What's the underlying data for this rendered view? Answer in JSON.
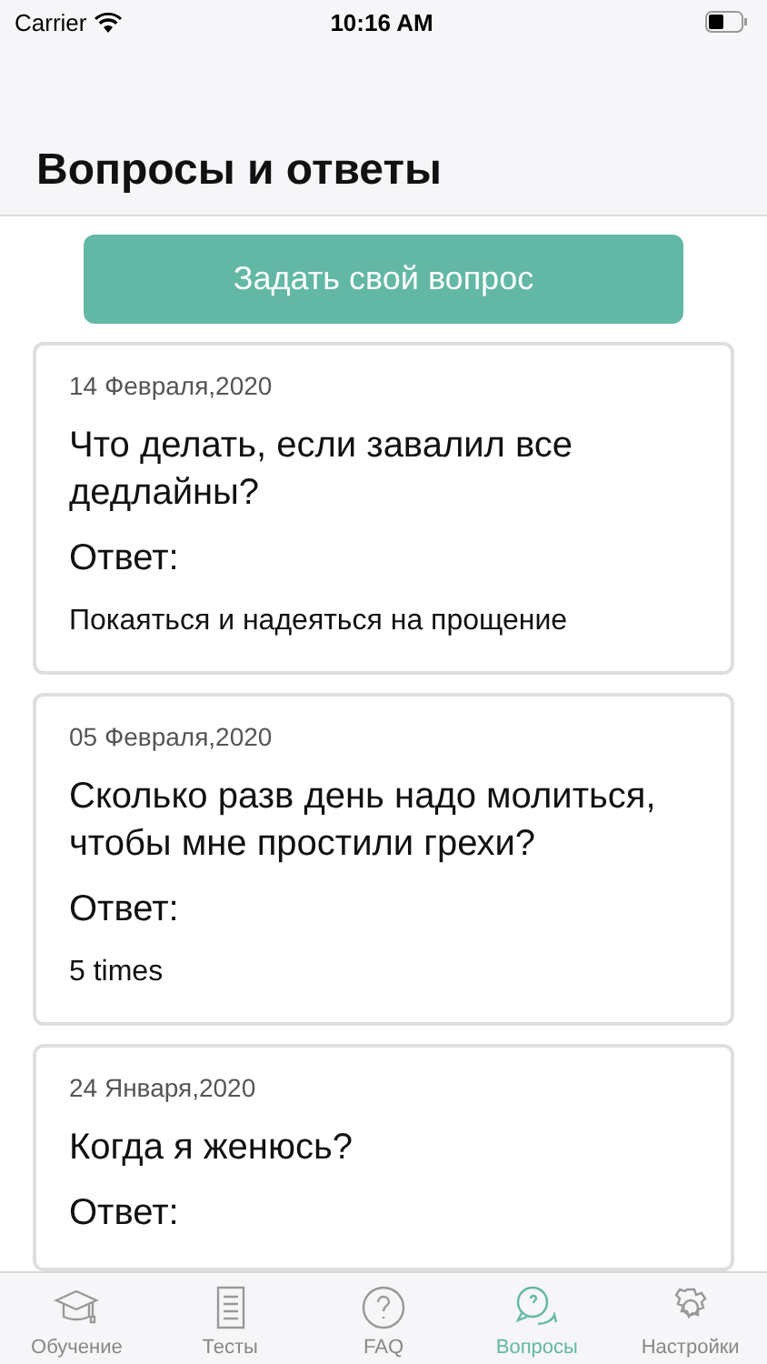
{
  "status_bar": {
    "carrier": "Carrier",
    "time": "10:16 AM"
  },
  "title": "Вопросы и ответы",
  "ask_button": "Задать свой вопрос",
  "questions": [
    {
      "date": "14 Февраля,2020",
      "question": "Что делать, если завалил все дедлайны?",
      "answer_label": "Ответ:",
      "answer": "Покаяться и надеяться на прощение"
    },
    {
      "date": "05 Февраля,2020",
      "question": "Сколько разв день надо молиться, чтобы мне простили грехи?",
      "answer_label": "Ответ:",
      "answer": "5 times"
    },
    {
      "date": "24 Января,2020",
      "question": "Когда я женюсь?",
      "answer_label": "Ответ:"
    }
  ],
  "tabs": [
    {
      "kind": "cap",
      "label": "Обучение",
      "selected": false
    },
    {
      "kind": "list",
      "label": "Тесты",
      "selected": false
    },
    {
      "kind": "faq",
      "label": "FAQ",
      "selected": false
    },
    {
      "kind": "chat",
      "label": "Вопросы",
      "selected": true
    },
    {
      "kind": "gear",
      "label": "Настройки",
      "selected": false
    }
  ]
}
